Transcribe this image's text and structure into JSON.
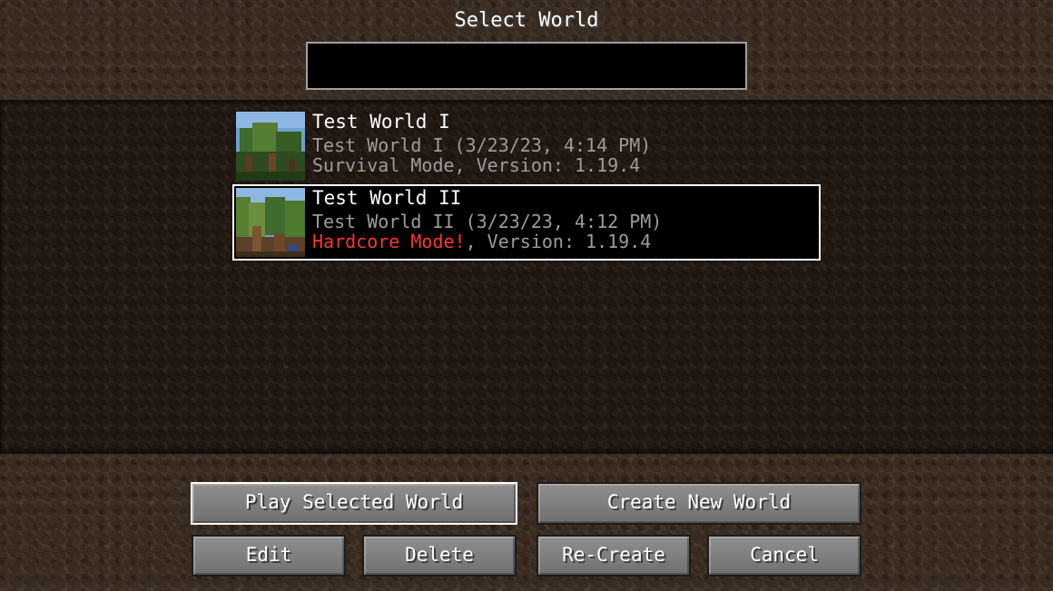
{
  "screen": {
    "title": "Select World"
  },
  "search": {
    "value": "",
    "placeholder": ""
  },
  "worlds": [
    {
      "name": "Test World I",
      "detail": "Test World I (3/23/23, 4:14 PM)",
      "mode": "Survival Mode",
      "version": "Version: 1.19.4",
      "selected": false,
      "icon": "world-thumbnail-icon"
    },
    {
      "name": "Test World II",
      "detail": "Test World II (3/23/23, 4:12 PM)",
      "mode": "Hardcore Mode!",
      "version": "Version: 1.19.4",
      "selected": true,
      "icon": "world-thumbnail-icon"
    }
  ],
  "buttons": {
    "play": "Play Selected World",
    "create": "Create New World",
    "edit": "Edit",
    "delete": "Delete",
    "recreate": "Re-Create",
    "cancel": "Cancel"
  },
  "colors": {
    "hardcore": "#ff3333",
    "selected_border": "#ffffff",
    "detail_text": "#9c9c9c"
  }
}
